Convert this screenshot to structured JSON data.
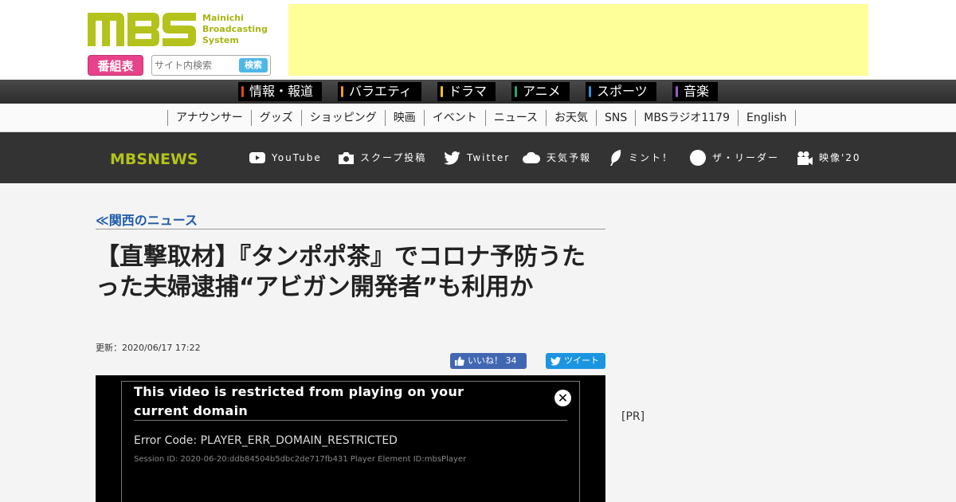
{
  "header": {
    "logo_text": "MBS",
    "logo_subtext": "Mainichi\nBroadcasting\nSystem",
    "bangumi_label": "番組表",
    "search_placeholder": "サイト内検索",
    "search_button": "検索"
  },
  "genre_nav": [
    {
      "label": "情報・報道",
      "color": "#e2432c"
    },
    {
      "label": "バラエティ",
      "color": "#f39a1f"
    },
    {
      "label": "ドラマ",
      "color": "#f3c41f"
    },
    {
      "label": "アニメ",
      "color": "#2ca56b"
    },
    {
      "label": "スポーツ",
      "color": "#3a8ed4"
    },
    {
      "label": "音楽",
      "color": "#9a5cc6"
    }
  ],
  "sub_nav": [
    "アナウンサー",
    "グッズ",
    "ショッピング",
    "映画",
    "イベント",
    "ニュース",
    "お天気",
    "SNS",
    "MBSラジオ1179",
    "English"
  ],
  "news_bar": {
    "logo": "MBSNEWS",
    "links": [
      {
        "label": "YouTube",
        "icon": "youtube-icon"
      },
      {
        "label": "スクープ投稿",
        "icon": "camera-icon"
      },
      {
        "label": "Twitter",
        "icon": "twitter-icon"
      },
      {
        "label": "天気予報",
        "icon": "cloud-icon"
      },
      {
        "label": "ミント！",
        "icon": "leaf-icon"
      },
      {
        "label": "ザ・リーダー",
        "icon": "circle-icon"
      },
      {
        "label": "映像'20",
        "icon": "video-camera-icon"
      }
    ]
  },
  "article": {
    "breadcrumb": "≪関西のニュース",
    "headline": "【直撃取材】『タンポポ茶』でコロナ予防うたった夫婦逮捕“アビガン開発者”も利用か",
    "updated": "更新：2020/06/17 17:22",
    "like_label": "いいね！ 34",
    "tweet_label": "ツイート"
  },
  "video_error": {
    "title": "This video is restricted from playing on your current domain",
    "code": "Error Code: PLAYER_ERR_DOMAIN_RESTRICTED",
    "session": "Session ID: 2020-06-20:ddb84504b5dbc2de717fb431 Player Element ID:mbsPlayer",
    "close": "✕"
  },
  "sidebar": {
    "pr_label": "[PR]"
  },
  "colors": {
    "brand_green": "#b4c31b",
    "link_blue": "#1c5aa8",
    "news_bar": "#333333"
  }
}
